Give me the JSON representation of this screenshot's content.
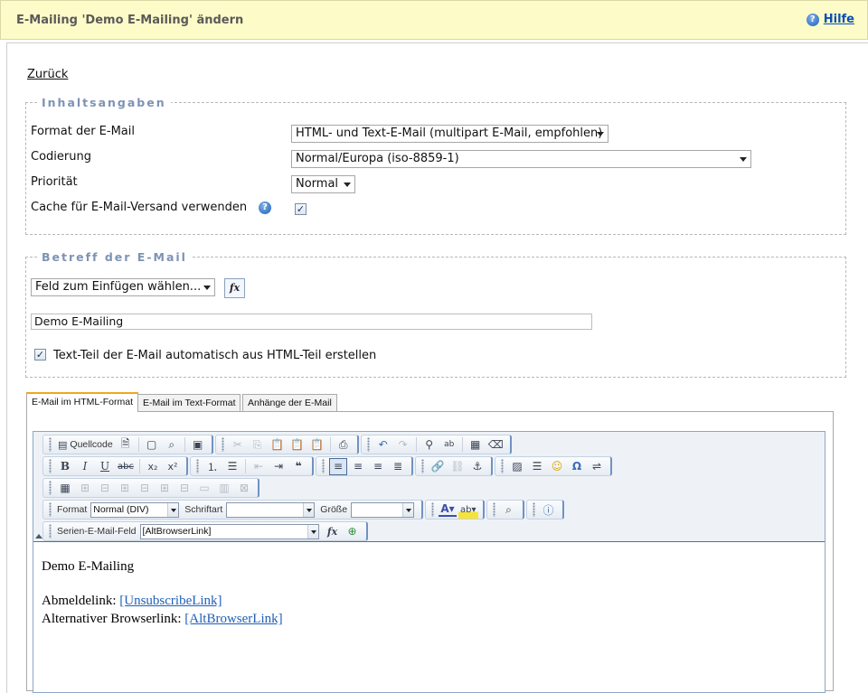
{
  "header": {
    "title": "E-Mailing 'Demo E-Mailing' ändern",
    "help_label": "Hilfe",
    "help_icon": "help-icon"
  },
  "nav": {
    "back_label": "Zurück"
  },
  "content_section": {
    "legend": "Inhaltsangaben",
    "format_label": "Format der E-Mail",
    "format_value": "HTML- und Text-E-Mail (multipart E-Mail, empfohlen)",
    "encoding_label": "Codierung",
    "encoding_value": "Normal/Europa (iso-8859-1)",
    "priority_label": "Priorität",
    "priority_value": "Normal",
    "cache_label": "Cache für E-Mail-Versand verwenden",
    "cache_checked": true
  },
  "subject_section": {
    "legend": "Betreff der E-Mail",
    "field_select_value": "Feld zum Einfügen wählen...",
    "fx_label": "fx",
    "subject_value": "Demo E-Mailing",
    "auto_text_label": "Text-Teil der E-Mail automatisch aus HTML-Teil erstellen",
    "auto_text_checked": true
  },
  "tabs": [
    {
      "label": "E-Mail im HTML-Format",
      "active": true
    },
    {
      "label": "E-Mail im Text-Format",
      "active": false
    },
    {
      "label": "Anhänge der E-Mail",
      "active": false
    }
  ],
  "editor": {
    "toolbar": {
      "source_label": "Quellcode",
      "format_label": "Format",
      "format_value": "Normal (DIV)",
      "font_label": "Schriftart",
      "font_value": "",
      "size_label": "Größe",
      "size_value": "",
      "merge_field_label": "Serien-E-Mail-Feld",
      "merge_field_value": "[AltBrowserLink]",
      "fx_label": "fx"
    },
    "document": {
      "heading": "Demo E-Mailing",
      "unsubscribe_label": "Abmeldelink: ",
      "unsubscribe_link": "[UnsubscribeLink]",
      "browser_label": "Alternativer Browserlink: ",
      "browser_link": "[AltBrowserLink]"
    }
  },
  "colors": {
    "header_bg": "#fdfcc8",
    "legend": "#7d93b4",
    "link": "#1f5fb8",
    "active_tab_accent": "#f0a71e"
  }
}
